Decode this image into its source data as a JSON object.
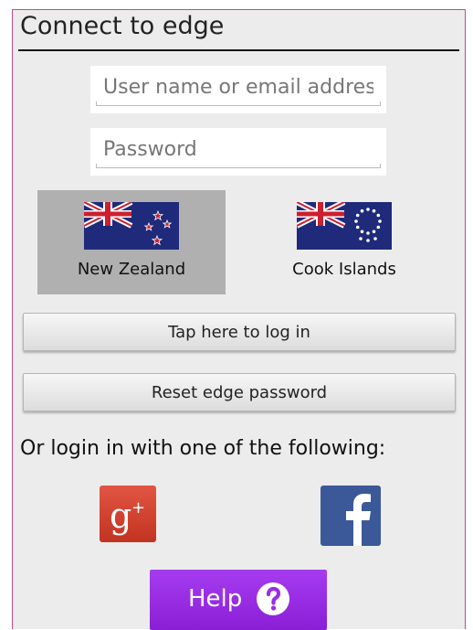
{
  "header": {
    "title": "Connect to edge"
  },
  "form": {
    "username_placeholder": "User name or email address",
    "password_placeholder": "Password"
  },
  "regions": [
    {
      "label": "New Zealand",
      "selected": true,
      "icon": "new-zealand-flag-icon"
    },
    {
      "label": "Cook Islands",
      "selected": false,
      "icon": "cook-islands-flag-icon"
    }
  ],
  "actions": {
    "login_label": "Tap here to log in",
    "reset_label": "Reset edge password"
  },
  "social": {
    "prompt": "Or login in with one of the following:",
    "providers": [
      {
        "icon": "google-plus-icon",
        "color": "#d13f2c"
      },
      {
        "icon": "facebook-icon",
        "color": "#3b5998"
      }
    ]
  },
  "help": {
    "label": "Help",
    "icon": "question-mark-icon",
    "color": "#9a2ee6"
  }
}
